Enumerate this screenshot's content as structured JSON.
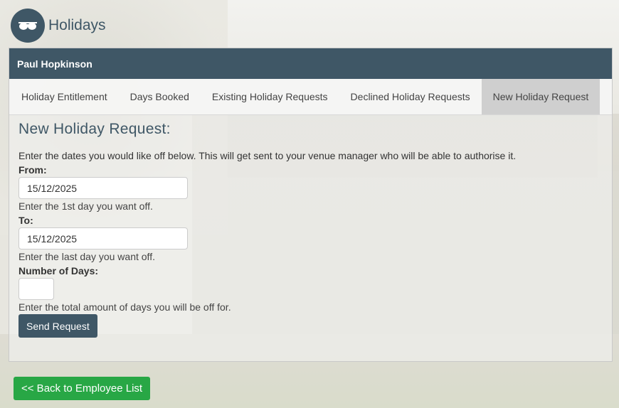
{
  "app": {
    "title": "Holidays",
    "logo_icon": "sunglasses-icon"
  },
  "employee": {
    "name": "Paul Hopkinson"
  },
  "tabs": [
    {
      "label": "Holiday Entitlement",
      "active": false
    },
    {
      "label": "Days Booked",
      "active": false
    },
    {
      "label": "Existing Holiday Requests",
      "active": false
    },
    {
      "label": "Declined Holiday Requests",
      "active": false
    },
    {
      "label": "New Holiday Request",
      "active": true
    }
  ],
  "form": {
    "heading": "New Holiday Request:",
    "intro": "Enter the dates you would like off below. This will get sent to your venue manager who will be able to authorise it.",
    "from_label": "From:",
    "from_value": "15/12/2025",
    "from_help": "Enter the 1st day you want off.",
    "to_label": "To:",
    "to_value": "15/12/2025",
    "to_help": "Enter the last day you want off.",
    "days_label": "Number of Days:",
    "days_value": "",
    "days_help": "Enter the total amount of days you will be off for.",
    "send_label": "Send Request"
  },
  "back_button": "<< Back to Employee List",
  "colors": {
    "primary": "#3f5766",
    "success": "#28a745",
    "active_tab": "#cfcfcf"
  }
}
